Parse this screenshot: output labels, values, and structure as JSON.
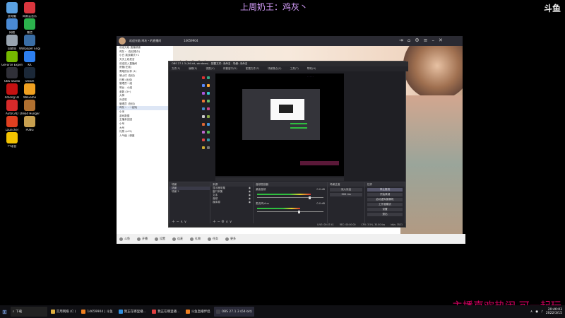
{
  "overlay": {
    "top_text": "上周奶王：鸡灰丶",
    "bottom_text": "主播喜欢热闹 可一起玩",
    "platform_logo": "斗鱼"
  },
  "desktop_icons": [
    {
      "label": "此电脑",
      "color": "#5aa0e0"
    },
    {
      "label": "网易云音乐",
      "color": "#d9363e"
    },
    {
      "label": "网络",
      "color": "#4a8ad4"
    },
    {
      "label": "微信",
      "color": "#2bb24c"
    },
    {
      "label": "回收站",
      "color": "#9aa5b0"
    },
    {
      "label": "Wallpaper Engine",
      "color": "#3a6ea5"
    },
    {
      "label": "GeForce Experience",
      "color": "#76b900"
    },
    {
      "label": "KK",
      "color": "#2d7ff0"
    },
    {
      "label": "OBS Studio",
      "color": "#303038"
    },
    {
      "label": "Steam",
      "color": "#1b2838"
    },
    {
      "label": "Among Us",
      "color": "#c51111"
    },
    {
      "label": "WeGame",
      "color": "#f0a020"
    },
    {
      "label": "AutoCAD",
      "color": "#d72a2a"
    },
    {
      "label": "Dread Hunger",
      "color": "#b07030"
    },
    {
      "label": "Launcher",
      "color": "#e04020"
    },
    {
      "label": "PUBG",
      "color": "#c8a050"
    },
    {
      "label": "YY语音",
      "color": "#f2c200"
    }
  ],
  "taskbar": {
    "search_placeholder": "下载",
    "items": [
      {
        "label": "实用网络 (C:)",
        "color": "#e0b040",
        "active": false
      },
      {
        "label": "14659904 | 斗鱼",
        "color": "#f08020",
        "active": false
      },
      {
        "label": "我正在哪里播…",
        "color": "#3090e0",
        "active": false
      },
      {
        "label": "我正在哪里播…",
        "color": "#e04040",
        "active": false
      },
      {
        "label": "斗鱼直播伴侣",
        "color": "#f08020",
        "active": false
      },
      {
        "label": "OBS 27.1.3 (64-bit)",
        "color": "#404048",
        "active": true
      }
    ],
    "time": "20:40:03",
    "date": "2022/3/15"
  },
  "main_window": {
    "title": "欢迎光临 鸡灰丶的直播间",
    "room_id": "14659904",
    "left_list": [
      "欢迎光临 直播频道",
      "鸡灰丶 (在线观众)",
      "小白 挑战模式+1",
      "天天上线发言",
      "欢迎进入直播间",
      "房管(在线)",
      "黑暗的伙伴 (1)",
      "骑士们 (在线)",
      "日程 (出没)",
      "管理员一组",
      "吧台 - 小组",
      "参数 (3+)",
      "大神",
      "对讲机",
      "管理员 (在线)",
      "鸡灰丶 - 一起玩",
      "小米",
      "游戏数据",
      "主播亲友团",
      "小号",
      "大号",
      "礼物 (x12)",
      "人气值 / 弹幕"
    ],
    "selected_index": 15,
    "bottom_buttons": [
      "斗鱼",
      "开播",
      "设置",
      "连麦",
      "礼物",
      "任务",
      "更多"
    ]
  },
  "obs": {
    "title": "OBS 27.1.3 (64-bit, windows) - 配置文件: 未命名 - 场景: 未命名",
    "menu": [
      "文件(F)",
      "编辑(E)",
      "视图(V)",
      "停靠窗口(D)",
      "配置文件(P)",
      "场景集合(S)",
      "工具(T)",
      "帮助(H)"
    ],
    "scenes_header": "场景",
    "scenes": [
      "场景",
      "场景 2"
    ],
    "sources_header": "来源",
    "sources": [
      "显示器采集",
      "窗口采集",
      "文本",
      "音频",
      "媒体源"
    ],
    "mixer_header": "音频混音器",
    "mixer_tracks": [
      {
        "name": "桌面音频",
        "db": "0.0 dB",
        "level": 0.78
      },
      {
        "name": "麦克风/Aux",
        "db": "0.0 dB",
        "level": 0.62
      }
    ],
    "transitions_header": "场景过渡",
    "transition_type": "淡入淡出",
    "duration": "300 ms",
    "controls_header": "控件",
    "controls": [
      "停止推流",
      "开始录制",
      "启动虚拟摄像机",
      "工作室模式",
      "设置",
      "退出"
    ],
    "status": {
      "live": "LIVE: 00:47:41",
      "rec": "REC: 00:00:00",
      "cpu": "CPU: 3.5%, 30.00 fps",
      "kbps": "kb/s: 3521"
    }
  }
}
